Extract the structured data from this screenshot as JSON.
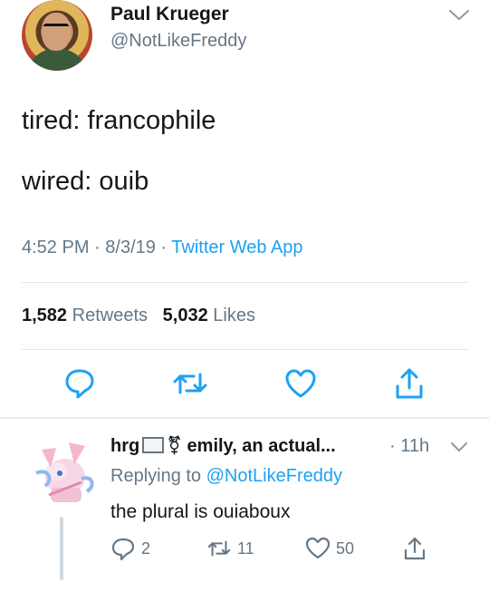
{
  "author": {
    "name": "Paul Krueger",
    "handle": "@NotLikeFreddy",
    "avatar_icon": "profile-photo"
  },
  "tweet": {
    "lines": [
      "tired: francophile",
      "wired: ouib"
    ],
    "time": "4:52 PM",
    "sep1": " · ",
    "date": "8/3/19",
    "sep2": " · ",
    "source": "Twitter Web App",
    "retweets_count": "1,582",
    "retweets_label": "Retweets",
    "likes_count": "5,032",
    "likes_label": "Likes"
  },
  "actions": [
    "reply-icon",
    "retweet-icon",
    "like-icon",
    "share-icon"
  ],
  "reply": {
    "name_part1": "hrg",
    "name_part2": "⚧ emily, an actual...",
    "time": "· 11h",
    "replying_prefix": "Replying to ",
    "replying_to": "@NotLikeFreddy",
    "text": "the plural is ouiaboux",
    "reply_count": "2",
    "retweet_count": "11",
    "like_count": "50"
  },
  "colors": {
    "link": "#1da1f2",
    "secondary": "#657786",
    "divider": "#e1e8ed"
  }
}
